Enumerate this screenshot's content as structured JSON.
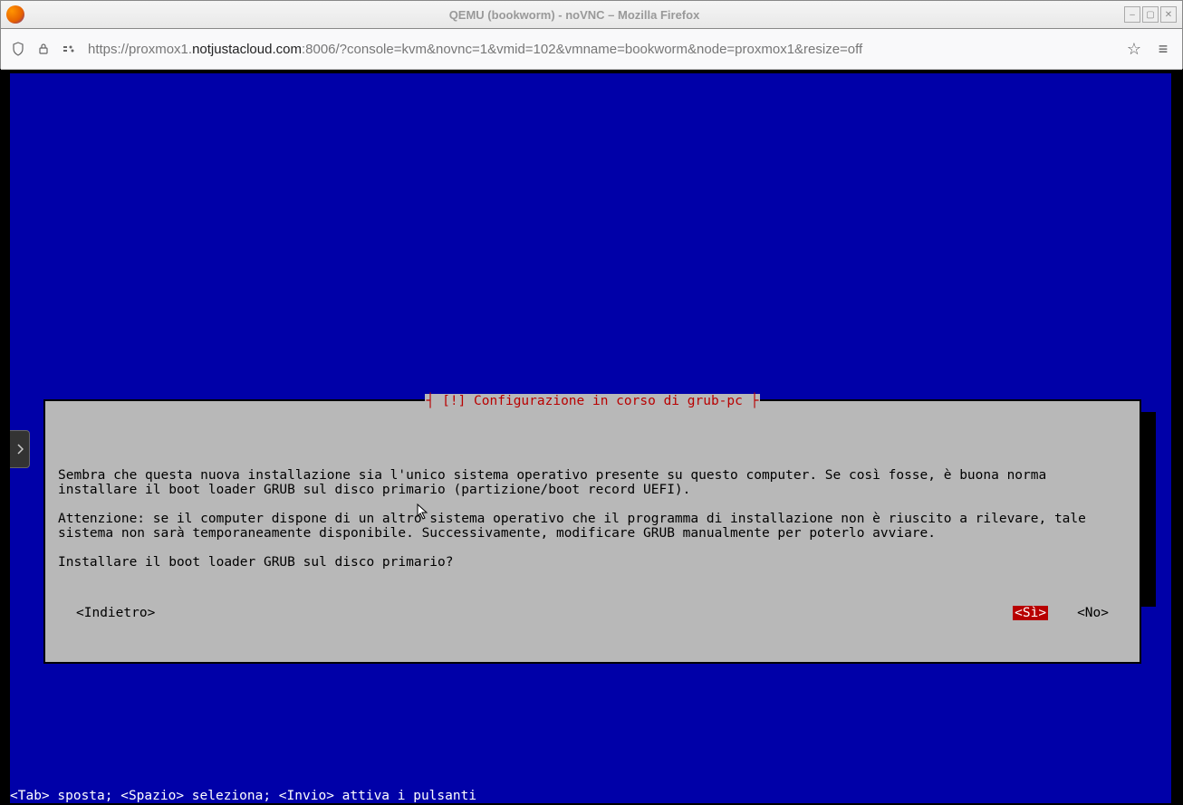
{
  "window": {
    "title": "QEMU (bookworm) - noVNC – Mozilla Firefox",
    "controls": {
      "min": "–",
      "max": "▢",
      "close": "✕"
    }
  },
  "address": {
    "shield": "◯",
    "lock": "🔒",
    "perm": "⚙",
    "url_prefix": "https://proxmox1.",
    "url_host": "notjustacloud.com",
    "url_suffix": ":8006/?console=kvm&novnc=1&vmid=102&vmname=bookworm&node=proxmox1&resize=off",
    "star": "☆",
    "menu": "≡"
  },
  "novnc": {
    "handle": "▸"
  },
  "dialog": {
    "title": "┤ [!] Configurazione in corso di grub-pc ├",
    "para1": "Sembra che questa nuova installazione sia l'unico sistema operativo presente su questo computer. Se così fosse, è buona norma installare il boot loader GRUB sul disco primario (partizione/boot record UEFI).",
    "para2": "Attenzione: se il computer dispone di un altro sistema operativo che il programma di installazione non è riuscito a rilevare, tale sistema non sarà temporaneamente disponibile. Successivamente, modificare GRUB manualmente per poterlo avviare.",
    "para3": "Installare il boot loader GRUB sul disco primario?",
    "back": "<Indietro>",
    "yes": "<Sì>",
    "no": "<No>"
  },
  "hint": "<Tab> sposta; <Spazio> seleziona; <Invio> attiva i pulsanti"
}
